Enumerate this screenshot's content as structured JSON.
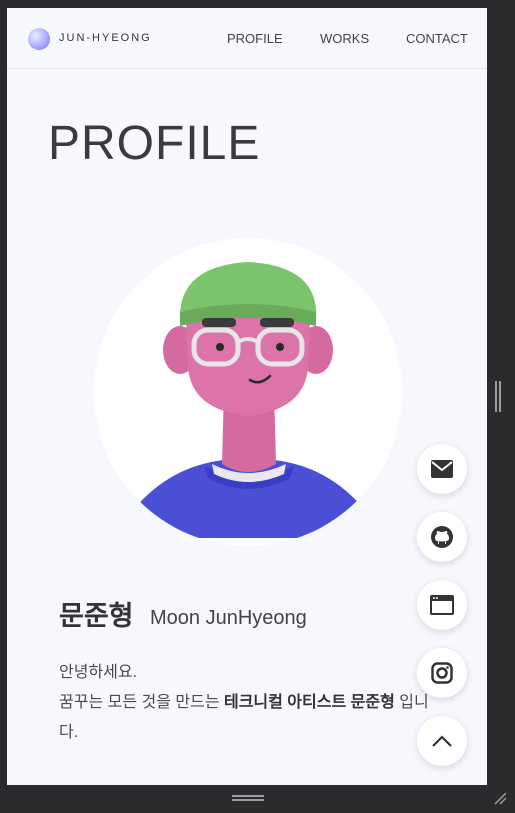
{
  "header": {
    "brand": "JUN-HYEONG",
    "nav": [
      "PROFILE",
      "WORKS",
      "CONTACT"
    ]
  },
  "page": {
    "title": "PROFILE"
  },
  "profile": {
    "name_ko": "문준형",
    "name_en": "Moon JunHyeong",
    "greeting": "안녕하세요.",
    "intro_prefix": "꿈꾸는 모든 것을 만드는 ",
    "intro_bold": "테크니컬 아티스트 문준형",
    "intro_suffix": " 입니다."
  },
  "floating_buttons": [
    "mail-icon",
    "github-icon",
    "browser-window-icon",
    "instagram-icon",
    "chevron-up-icon"
  ],
  "colors": {
    "page_bg": "#f7f8fd",
    "text_dark": "#333333",
    "logo_accent": "#6f6bf2"
  }
}
